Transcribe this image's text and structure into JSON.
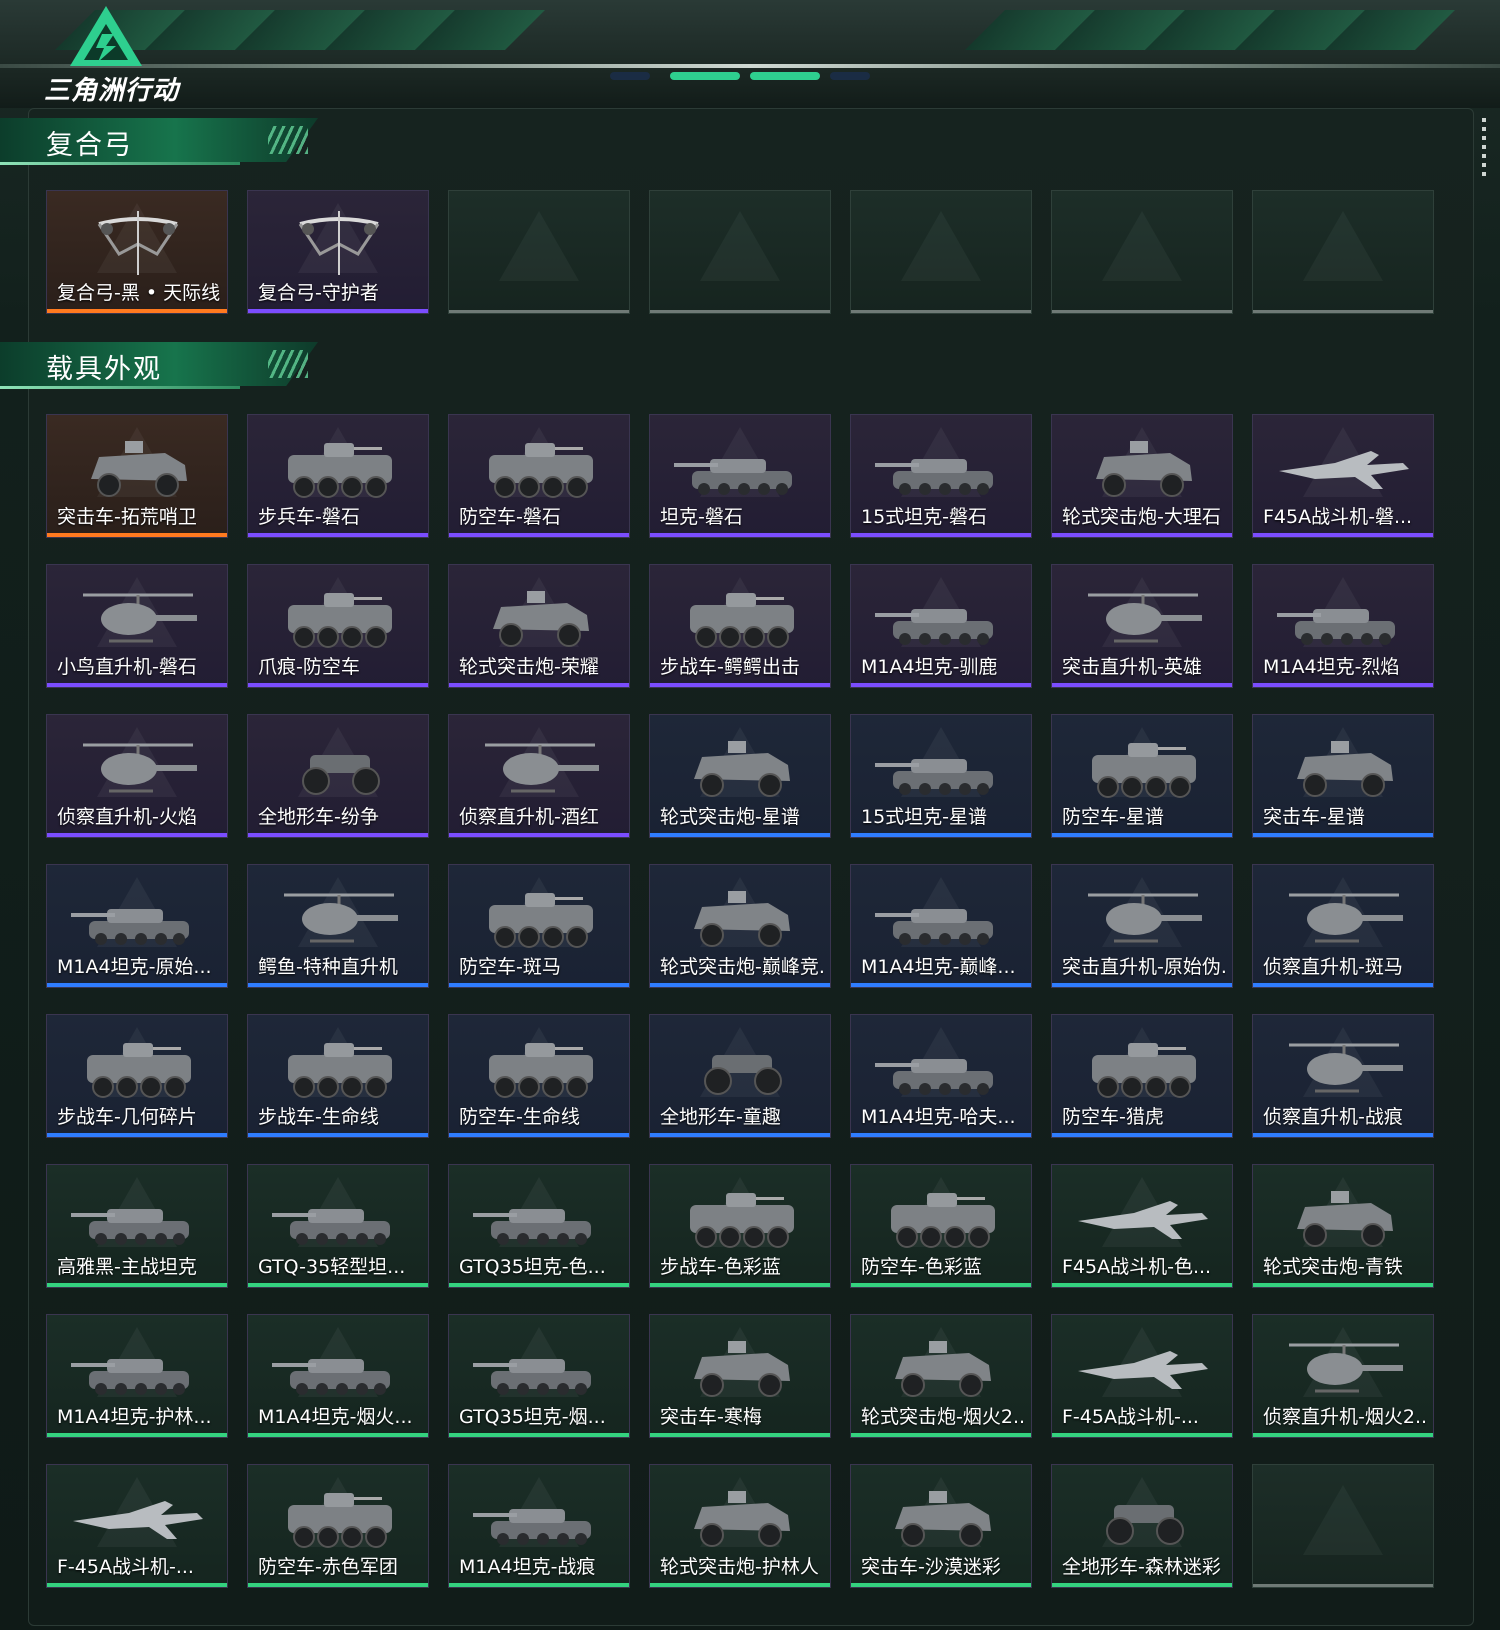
{
  "header": {
    "logo_text": "三角洲行动",
    "accent": "#2ecf8f"
  },
  "sections": [
    {
      "title": "复合弓",
      "items": [
        {
          "label": "复合弓-黑 • 天际线",
          "rarity": "orange",
          "kind": "bow"
        },
        {
          "label": "复合弓-守护者",
          "rarity": "purple",
          "kind": "bow"
        },
        {
          "label": "",
          "rarity": "empty",
          "kind": "empty"
        },
        {
          "label": "",
          "rarity": "empty",
          "kind": "empty"
        },
        {
          "label": "",
          "rarity": "empty",
          "kind": "empty"
        },
        {
          "label": "",
          "rarity": "empty",
          "kind": "empty"
        },
        {
          "label": "",
          "rarity": "empty",
          "kind": "empty"
        }
      ]
    },
    {
      "title": "载具外观",
      "items": [
        {
          "label": "突击车-拓荒哨卫",
          "rarity": "orange",
          "kind": "car"
        },
        {
          "label": "步兵车-磐石",
          "rarity": "purple",
          "kind": "apc"
        },
        {
          "label": "防空车-磐石",
          "rarity": "purple",
          "kind": "apc"
        },
        {
          "label": "坦克-磐石",
          "rarity": "purple",
          "kind": "tank"
        },
        {
          "label": "15式坦克-磐石",
          "rarity": "purple",
          "kind": "tank"
        },
        {
          "label": "轮式突击炮-大理石",
          "rarity": "purple",
          "kind": "car"
        },
        {
          "label": "F45A战斗机-磐...",
          "rarity": "purple",
          "kind": "jet"
        },
        {
          "label": "小鸟直升机-磐石",
          "rarity": "purple",
          "kind": "heli"
        },
        {
          "label": "爪痕-防空车",
          "rarity": "purple",
          "kind": "apc"
        },
        {
          "label": "轮式突击炮-荣耀",
          "rarity": "purple",
          "kind": "car"
        },
        {
          "label": "步战车-鳄鳄出击",
          "rarity": "purple",
          "kind": "apc"
        },
        {
          "label": "M1A4坦克-驯鹿",
          "rarity": "purple",
          "kind": "tank"
        },
        {
          "label": "突击直升机-英雄",
          "rarity": "purple",
          "kind": "heli"
        },
        {
          "label": "M1A4坦克-烈焰",
          "rarity": "purple",
          "kind": "tank"
        },
        {
          "label": "侦察直升机-火焰",
          "rarity": "purple",
          "kind": "heli"
        },
        {
          "label": "全地形车-纷争",
          "rarity": "purple",
          "kind": "atv"
        },
        {
          "label": "侦察直升机-酒红",
          "rarity": "purple",
          "kind": "heli"
        },
        {
          "label": "轮式突击炮-星谱",
          "rarity": "blue",
          "kind": "car"
        },
        {
          "label": "15式坦克-星谱",
          "rarity": "blue",
          "kind": "tank"
        },
        {
          "label": "防空车-星谱",
          "rarity": "blue",
          "kind": "apc"
        },
        {
          "label": "突击车-星谱",
          "rarity": "blue",
          "kind": "car"
        },
        {
          "label": "M1A4坦克-原始...",
          "rarity": "blue",
          "kind": "tank"
        },
        {
          "label": "鳄鱼-特种直升机",
          "rarity": "blue",
          "kind": "heli"
        },
        {
          "label": "防空车-斑马",
          "rarity": "blue",
          "kind": "apc"
        },
        {
          "label": "轮式突击炮-巅峰竞...",
          "rarity": "blue",
          "kind": "car"
        },
        {
          "label": "M1A4坦克-巅峰...",
          "rarity": "blue",
          "kind": "tank"
        },
        {
          "label": "突击直升机-原始伪...",
          "rarity": "blue",
          "kind": "heli"
        },
        {
          "label": "侦察直升机-斑马",
          "rarity": "blue",
          "kind": "heli"
        },
        {
          "label": "步战车-几何碎片",
          "rarity": "blue",
          "kind": "apc"
        },
        {
          "label": "步战车-生命线",
          "rarity": "blue",
          "kind": "apc"
        },
        {
          "label": "防空车-生命线",
          "rarity": "blue",
          "kind": "apc"
        },
        {
          "label": "全地形车-童趣",
          "rarity": "blue",
          "kind": "atv"
        },
        {
          "label": "M1A4坦克-哈夫...",
          "rarity": "blue",
          "kind": "tank"
        },
        {
          "label": "防空车-猎虎",
          "rarity": "blue",
          "kind": "apc"
        },
        {
          "label": "侦察直升机-战痕",
          "rarity": "blue",
          "kind": "heli"
        },
        {
          "label": "高雅黑-主战坦克",
          "rarity": "green",
          "kind": "tank"
        },
        {
          "label": "GTQ-35轻型坦...",
          "rarity": "green",
          "kind": "tank"
        },
        {
          "label": "GTQ35坦克-色...",
          "rarity": "green",
          "kind": "tank"
        },
        {
          "label": "步战车-色彩蓝",
          "rarity": "green",
          "kind": "apc"
        },
        {
          "label": "防空车-色彩蓝",
          "rarity": "green",
          "kind": "apc"
        },
        {
          "label": "F45A战斗机-色...",
          "rarity": "green",
          "kind": "jet"
        },
        {
          "label": "轮式突击炮-青铁",
          "rarity": "green",
          "kind": "car"
        },
        {
          "label": "M1A4坦克-护林...",
          "rarity": "green",
          "kind": "tank"
        },
        {
          "label": "M1A4坦克-烟火...",
          "rarity": "green",
          "kind": "tank"
        },
        {
          "label": "GTQ35坦克-烟...",
          "rarity": "green",
          "kind": "tank"
        },
        {
          "label": "突击车-寒梅",
          "rarity": "green",
          "kind": "car"
        },
        {
          "label": "轮式突击炮-烟火2...",
          "rarity": "green",
          "kind": "car"
        },
        {
          "label": "F-45A战斗机-...",
          "rarity": "green",
          "kind": "jet"
        },
        {
          "label": "侦察直升机-烟火2...",
          "rarity": "green",
          "kind": "heli"
        },
        {
          "label": "F-45A战斗机-...",
          "rarity": "green",
          "kind": "jet"
        },
        {
          "label": "防空车-赤色军团",
          "rarity": "green",
          "kind": "apc"
        },
        {
          "label": "M1A4坦克-战痕",
          "rarity": "green",
          "kind": "tank"
        },
        {
          "label": "轮式突击炮-护林人",
          "rarity": "green",
          "kind": "car"
        },
        {
          "label": "突击车-沙漠迷彩",
          "rarity": "green",
          "kind": "car"
        },
        {
          "label": "全地形车-森林迷彩",
          "rarity": "green",
          "kind": "atv"
        },
        {
          "label": "",
          "rarity": "empty",
          "kind": "empty"
        }
      ]
    }
  ],
  "rarity_colors": {
    "orange": {
      "strip": "#ff7a1f",
      "top": "#3a2a22",
      "bottom": "#2a1f1a"
    },
    "purple": {
      "strip": "#7b4dff",
      "top": "#2b2538",
      "bottom": "#221d33"
    },
    "blue": {
      "strip": "#2f7dff",
      "top": "#1e2738",
      "bottom": "#1a2233"
    },
    "green": {
      "strip": "#34d27f",
      "top": "#1b2e27",
      "bottom": "#15251f"
    }
  }
}
